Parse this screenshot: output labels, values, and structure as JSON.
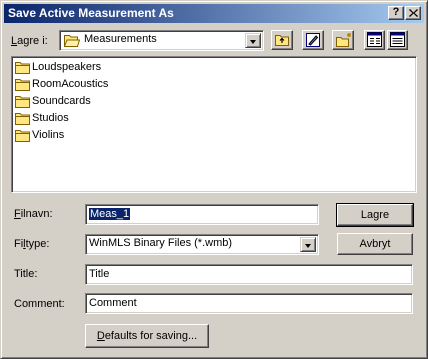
{
  "window": {
    "title": "Save Active Measurement As"
  },
  "titlebar_buttons": {
    "help": "?",
    "close": "✕"
  },
  "look_in": {
    "label_mnemonic": "L",
    "label_rest": "agre i:",
    "value": "Measurements"
  },
  "toolbar": {
    "icons": [
      "up-one-level-icon",
      "desktop-icon",
      "new-folder-icon",
      "list-view-icon",
      "details-view-icon"
    ]
  },
  "folders": [
    {
      "name": "Loudspeakers"
    },
    {
      "name": "RoomAcoustics"
    },
    {
      "name": "Soundcards"
    },
    {
      "name": "Studios"
    },
    {
      "name": "Violins"
    }
  ],
  "filename": {
    "label_mnemonic": "F",
    "label_rest": "ilnavn:",
    "value": "Meas_1"
  },
  "filetype": {
    "label_pre": "Fi",
    "label_mnemonic": "l",
    "label_rest": "type:",
    "value": "WinMLS Binary Files (*.wmb)"
  },
  "title_field": {
    "label": "Title:",
    "value": "Title"
  },
  "comment_field": {
    "label": "Comment:",
    "value": "Comment"
  },
  "buttons": {
    "save": "Lagre",
    "cancel": "Avbryt",
    "defaults_mnemonic": "D",
    "defaults_rest": "efaults for saving..."
  },
  "colors": {
    "titlebar_start": "#0a246a",
    "titlebar_end": "#a6caf0",
    "face": "#d4d0c8",
    "selection": "#0a246a"
  }
}
